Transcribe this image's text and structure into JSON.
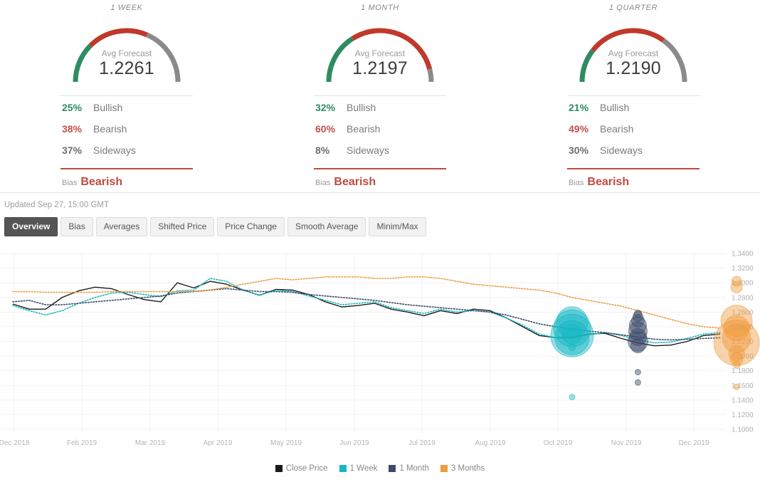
{
  "panels": [
    {
      "title": "1 WEEK",
      "gauge": {
        "label": "Avg Forecast",
        "value": "1.2261",
        "green_pct": 25,
        "red_pct": 38,
        "gray_pct": 37
      },
      "stats": [
        {
          "pct": "25%",
          "name": "Bullish",
          "color": "#2e8b62"
        },
        {
          "pct": "38%",
          "name": "Bearish",
          "color": "#c0504d"
        },
        {
          "pct": "37%",
          "name": "Sideways",
          "color": "#6e6e6e"
        }
      ],
      "bias_label": "Bias",
      "bias_value": "Bearish",
      "bias_color": "#bf4a3f"
    },
    {
      "title": "1 MONTH",
      "gauge": {
        "label": "Avg Forecast",
        "value": "1.2197",
        "green_pct": 32,
        "red_pct": 60,
        "gray_pct": 8
      },
      "stats": [
        {
          "pct": "32%",
          "name": "Bullish",
          "color": "#2e8b62"
        },
        {
          "pct": "60%",
          "name": "Bearish",
          "color": "#c0504d"
        },
        {
          "pct": "8%",
          "name": "Sideways",
          "color": "#6e6e6e"
        }
      ],
      "bias_label": "Bias",
      "bias_value": "Bearish",
      "bias_color": "#bf4a3f"
    },
    {
      "title": "1 QUARTER",
      "gauge": {
        "label": "Avg Forecast",
        "value": "1.2190",
        "green_pct": 21,
        "red_pct": 49,
        "gray_pct": 30
      },
      "stats": [
        {
          "pct": "21%",
          "name": "Bullish",
          "color": "#2e8b62"
        },
        {
          "pct": "49%",
          "name": "Bearish",
          "color": "#c0504d"
        },
        {
          "pct": "30%",
          "name": "Sideways",
          "color": "#6e6e6e"
        }
      ],
      "bias_label": "Bias",
      "bias_value": "Bearish",
      "bias_color": "#bf4a3f"
    }
  ],
  "updated": "Updated Sep 27, 15:00 GMT",
  "tabs": [
    {
      "label": "Overview",
      "active": true
    },
    {
      "label": "Bias",
      "active": false
    },
    {
      "label": "Averages",
      "active": false
    },
    {
      "label": "Shifted Price",
      "active": false
    },
    {
      "label": "Price Change",
      "active": false
    },
    {
      "label": "Smooth Average",
      "active": false
    },
    {
      "label": "Minim/Max",
      "active": false
    }
  ],
  "colors": {
    "close_price": "#1a1a1a",
    "one_week": "#16b8c4",
    "one_month": "#3b4a68",
    "three_months": "#ef9b3e",
    "green": "#2e8b62",
    "red": "#c0392b",
    "gray": "#8a8a8a",
    "grid": "#f0f0f0",
    "tab_active_bg": "#555555"
  },
  "chart_data": {
    "type": "line",
    "title": "",
    "xlabel": "",
    "ylabel": "",
    "ylim": [
      1.1,
      1.34
    ],
    "grid": true,
    "legend_position": "bottom",
    "ytick_labels": [
      "1.3400",
      "1.3200",
      "1.3000",
      "1.2800",
      "1.2600",
      "1.2400",
      "1.2200",
      "1.2000",
      "1.1800",
      "1.1600",
      "1.1400",
      "1.1200",
      "1.1000"
    ],
    "ytick_values": [
      1.34,
      1.32,
      1.3,
      1.28,
      1.26,
      1.24,
      1.22,
      1.2,
      1.18,
      1.16,
      1.14,
      1.12,
      1.1
    ],
    "xtick_labels": [
      "Dec 2018",
      "Feb 2019",
      "Mar 2019",
      "Apr 2019",
      "May 2019",
      "Jun 2019",
      "Jul 2019",
      "Aug 2019",
      "Oct 2019",
      "Nov 2019",
      "Dec 2019"
    ],
    "xtick_positions": [
      20,
      115,
      211,
      306,
      402,
      498,
      593,
      689,
      784,
      880,
      975
    ],
    "legend": [
      {
        "name": "Close Price",
        "color": "#1a1a1a",
        "style": "solid"
      },
      {
        "name": "1 Week",
        "color": "#16b8c4",
        "style": "dotted"
      },
      {
        "name": "1 Month",
        "color": "#3b4a68",
        "style": "dotted"
      },
      {
        "name": "3 Months",
        "color": "#ef9b3e",
        "style": "dotted"
      }
    ],
    "series": [
      {
        "name": "Close Price",
        "color": "#1a1a1a",
        "style": "solid",
        "values": [
          1.271,
          1.264,
          1.264,
          1.28,
          1.289,
          1.294,
          1.292,
          1.284,
          1.277,
          1.274,
          1.3,
          1.293,
          1.302,
          1.298,
          1.29,
          1.283,
          1.291,
          1.29,
          1.284,
          1.274,
          1.267,
          1.269,
          1.272,
          1.264,
          1.26,
          1.255,
          1.262,
          1.258,
          1.264,
          1.262,
          1.252,
          1.24,
          1.228,
          1.225,
          1.226,
          1.23,
          1.231,
          1.224,
          1.218,
          1.214,
          1.215,
          1.22,
          1.228,
          1.23
        ]
      },
      {
        "name": "1 Week",
        "color": "#16b8c4",
        "style": "dotted",
        "values": [
          1.269,
          1.262,
          1.256,
          1.262,
          1.272,
          1.28,
          1.286,
          1.287,
          1.284,
          1.281,
          1.289,
          1.29,
          1.306,
          1.302,
          1.29,
          1.283,
          1.29,
          1.288,
          1.282,
          1.276,
          1.27,
          1.272,
          1.274,
          1.266,
          1.262,
          1.258,
          1.264,
          1.26,
          1.262,
          1.26,
          1.252,
          1.242,
          1.23,
          1.225,
          1.224,
          1.229,
          1.232,
          1.228,
          1.222,
          1.218,
          1.219,
          1.224,
          1.23,
          1.232
        ]
      },
      {
        "name": "1 Month",
        "color": "#3b4a68",
        "style": "dotted",
        "values": [
          1.274,
          1.276,
          1.27,
          1.27,
          1.272,
          1.274,
          1.276,
          1.278,
          1.28,
          1.282,
          1.286,
          1.288,
          1.29,
          1.292,
          1.29,
          1.288,
          1.288,
          1.287,
          1.284,
          1.282,
          1.28,
          1.278,
          1.276,
          1.273,
          1.27,
          1.268,
          1.266,
          1.264,
          1.262,
          1.26,
          1.256,
          1.25,
          1.244,
          1.24,
          1.237,
          1.234,
          1.232,
          1.229,
          1.226,
          1.223,
          1.222,
          1.223,
          1.224,
          1.225
        ]
      },
      {
        "name": "3 Months",
        "color": "#ef9b3e",
        "style": "dotted",
        "values": [
          1.288,
          1.288,
          1.287,
          1.287,
          1.287,
          1.287,
          1.288,
          1.288,
          1.288,
          1.288,
          1.288,
          1.288,
          1.29,
          1.294,
          1.298,
          1.302,
          1.306,
          1.304,
          1.306,
          1.308,
          1.308,
          1.308,
          1.306,
          1.306,
          1.308,
          1.308,
          1.306,
          1.302,
          1.298,
          1.296,
          1.294,
          1.292,
          1.29,
          1.286,
          1.28,
          1.276,
          1.272,
          1.268,
          1.262,
          1.256,
          1.25,
          1.244,
          1.24,
          1.238
        ]
      }
    ],
    "bubble_clusters": [
      {
        "name": "1 Week",
        "color": "#16b8c4",
        "x_index": 34,
        "bubbles": [
          {
            "value": 1.246,
            "size": 22
          },
          {
            "value": 1.238,
            "size": 26
          },
          {
            "value": 1.228,
            "size": 30
          },
          {
            "value": 1.225,
            "size": 24
          },
          {
            "value": 1.23,
            "size": 14
          },
          {
            "value": 1.212,
            "size": 5
          },
          {
            "value": 1.144,
            "size": 4
          }
        ]
      },
      {
        "name": "1 Month",
        "color": "#3b4a68",
        "x_index": 38,
        "bubbles": [
          {
            "value": 1.258,
            "size": 5
          },
          {
            "value": 1.254,
            "size": 7
          },
          {
            "value": 1.248,
            "size": 9
          },
          {
            "value": 1.242,
            "size": 12
          },
          {
            "value": 1.234,
            "size": 13
          },
          {
            "value": 1.226,
            "size": 12
          },
          {
            "value": 1.22,
            "size": 14
          },
          {
            "value": 1.214,
            "size": 10
          },
          {
            "value": 1.178,
            "size": 4
          },
          {
            "value": 1.164,
            "size": 4
          }
        ]
      },
      {
        "name": "3 Months",
        "color": "#ef9b3e",
        "x_index": 44,
        "bubbles": [
          {
            "value": 1.302,
            "size": 7
          },
          {
            "value": 1.294,
            "size": 8
          },
          {
            "value": 1.248,
            "size": 22
          },
          {
            "value": 1.238,
            "size": 18
          },
          {
            "value": 1.218,
            "size": 32
          },
          {
            "value": 1.224,
            "size": 20
          },
          {
            "value": 1.204,
            "size": 11
          },
          {
            "value": 1.196,
            "size": 9
          },
          {
            "value": 1.188,
            "size": 5
          },
          {
            "value": 1.158,
            "size": 4
          }
        ]
      }
    ]
  }
}
